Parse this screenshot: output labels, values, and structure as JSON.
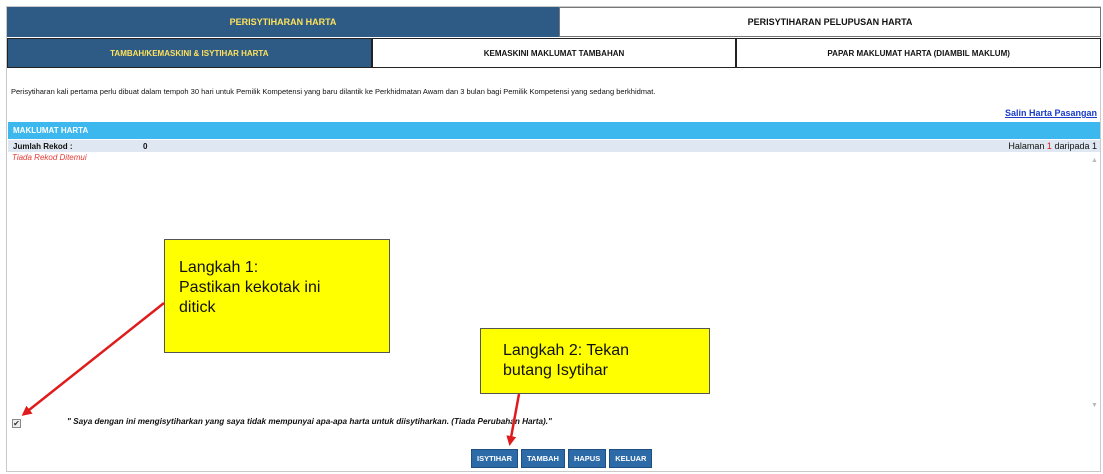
{
  "tabs_top": [
    {
      "label": "PERISYTIHARAN HARTA",
      "active": true
    },
    {
      "label": "PERISYTIHARAN PELUPUSAN HARTA",
      "active": false
    }
  ],
  "tabs_sub": [
    {
      "label": "TAMBAH/KEMASKINI & ISYTIHAR HARTA",
      "active": true
    },
    {
      "label": "KEMASKINI MAKLUMAT TAMBAHAN",
      "active": false
    },
    {
      "label": "PAPAR MAKLUMAT HARTA (DIAMBIL MAKLUM)",
      "active": false
    }
  ],
  "notice": "Perisytiharan kali pertama perlu dibuat dalam tempoh 30 hari untuk Pemilik Kompetensi yang baru dilantik ke Perkhidmatan Awam dan 3 bulan bagi Pemilik Kompetensi yang sedang berkhidmat.",
  "copy_link": "Salin Harta Pasangan",
  "section_title": "MAKLUMAT HARTA",
  "record_count": {
    "label": "Jumlah Rekod :",
    "value": "0"
  },
  "pager": {
    "prefix": "Halaman",
    "current": "1",
    "separator": "daripada",
    "total": "1"
  },
  "empty_text": "Tiada Rekod Ditemui",
  "declaration": {
    "checked": true,
    "check_mark": "✔",
    "text": "\" Saya dengan ini mengisytiharkan yang saya tidak mempunyai apa-apa harta untuk diisytiharkan. (Tiada Perubahan Harta).\""
  },
  "buttons": {
    "declare": "ISYTIHAR",
    "add": "TAMBAH",
    "delete": "HAPUS",
    "exit": "KELUAR"
  },
  "callouts": {
    "step1": {
      "line1": "Langkah 1:",
      "line2": "Pastikan kekotak ini",
      "line3": "ditick"
    },
    "step2": {
      "line1": "Langkah 2: Tekan",
      "line2": "butang Isytihar"
    }
  },
  "icons": {
    "scroll_up": "scroll-up-arrow",
    "scroll_down": "scroll-down-arrow",
    "arrow": "red-pointer-arrow"
  },
  "colors": {
    "tab_active": "#2d5b86",
    "tab_active_text": "#ffe25a",
    "section_head": "#3db8ef",
    "button": "#2d6ba8",
    "callout": "#ffff00",
    "arrow": "#e01b1b",
    "error_text": "#e53935"
  }
}
